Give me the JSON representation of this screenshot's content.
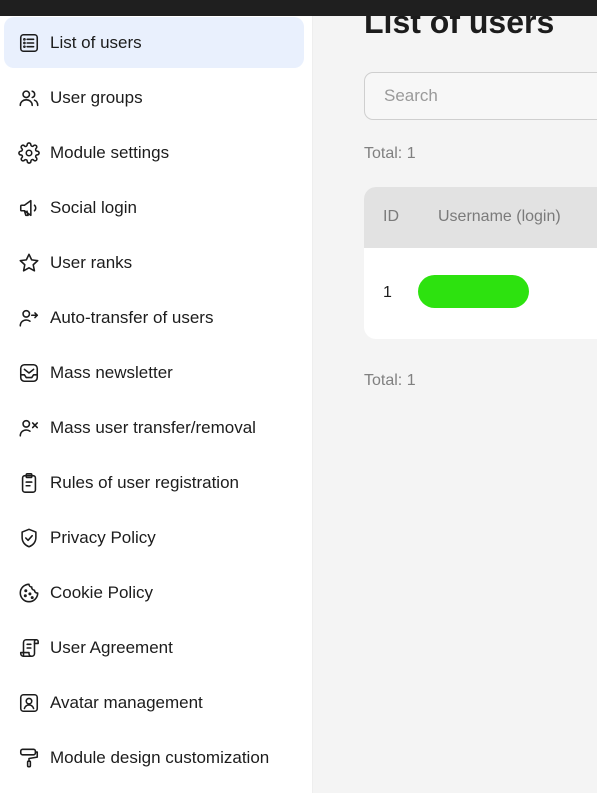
{
  "sidebar": {
    "items": [
      {
        "label": "List of users",
        "icon": "list-icon",
        "active": true
      },
      {
        "label": "User groups",
        "icon": "users-icon",
        "active": false
      },
      {
        "label": "Module settings",
        "icon": "gear-icon",
        "active": false
      },
      {
        "label": "Social login",
        "icon": "megaphone-icon",
        "active": false
      },
      {
        "label": "User ranks",
        "icon": "star-icon",
        "active": false
      },
      {
        "label": "Auto-transfer of users",
        "icon": "user-arrow-icon",
        "active": false
      },
      {
        "label": "Mass newsletter",
        "icon": "mail-icon",
        "active": false
      },
      {
        "label": "Mass user transfer/removal",
        "icon": "user-x-icon",
        "active": false
      },
      {
        "label": "Rules of user registration",
        "icon": "clipboard-icon",
        "active": false
      },
      {
        "label": "Privacy Policy",
        "icon": "shield-check-icon",
        "active": false
      },
      {
        "label": "Cookie Policy",
        "icon": "cookie-icon",
        "active": false
      },
      {
        "label": "User Agreement",
        "icon": "scroll-icon",
        "active": false
      },
      {
        "label": "Avatar management",
        "icon": "avatar-icon",
        "active": false
      },
      {
        "label": "Module design customization",
        "icon": "paint-roller-icon",
        "active": false
      }
    ]
  },
  "main": {
    "title": "List of users",
    "search": {
      "placeholder": "Search",
      "value": ""
    },
    "total_top": "Total: 1",
    "total_bottom": "Total: 1",
    "table": {
      "columns": [
        "ID",
        "Username (login)"
      ],
      "rows": [
        {
          "id": "1",
          "username": ""
        }
      ]
    }
  },
  "colors": {
    "active_bg": "#e9f0fd",
    "main_bg": "#f4f4f4",
    "redaction": "#2de20f",
    "topbar": "#1f1f1f"
  }
}
